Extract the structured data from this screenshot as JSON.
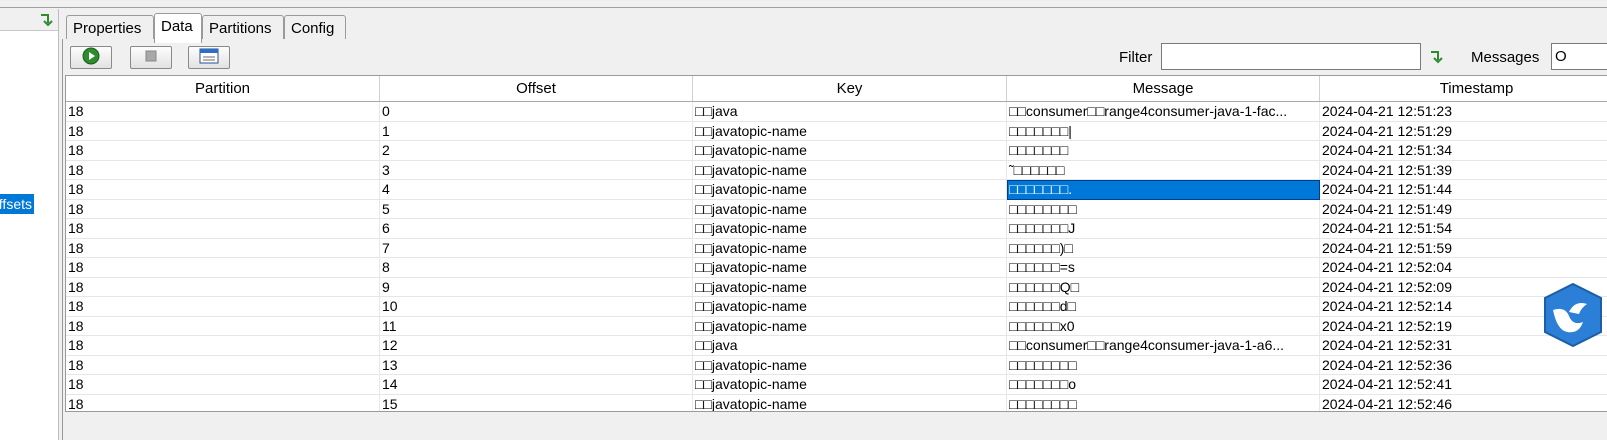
{
  "left": {
    "refresh_icon": "refresh-arrow-icon",
    "selected_item": "Offsets"
  },
  "tabs": [
    {
      "label": "Properties",
      "active": false
    },
    {
      "label": "Data",
      "active": true
    },
    {
      "label": "Partitions",
      "active": false
    },
    {
      "label": "Config",
      "active": false
    }
  ],
  "toolbar": {
    "play_icon": "play-icon",
    "stop_icon": "stop-icon",
    "window_icon": "window-icon",
    "filter_label": "Filter",
    "filter_value": "",
    "filter_apply_icon": "filter-arrow-icon",
    "messages_label": "Messages",
    "messages_value": "O"
  },
  "colors": {
    "selection": "#0078d7",
    "play_green": "#2e8b2e",
    "badge_blue": "#2b7fd6"
  },
  "table": {
    "columns": [
      "Partition",
      "Offset",
      "Key",
      "Message",
      "Timestamp"
    ],
    "selected_row": 4,
    "selected_column": "Message",
    "rows": [
      {
        "partition": "18",
        "offset": "0",
        "key": "□□java",
        "message": "□□consumer□□range4consumer-java-1-fac...",
        "timestamp": "2024-04-21 12:51:23"
      },
      {
        "partition": "18",
        "offset": "1",
        "key": "□□javatopic-name",
        "message": "□□□□□□□|",
        "timestamp": "2024-04-21 12:51:29"
      },
      {
        "partition": "18",
        "offset": "2",
        "key": "□□javatopic-name",
        "message": "□□□□□□□",
        "timestamp": "2024-04-21 12:51:34"
      },
      {
        "partition": "18",
        "offset": "3",
        "key": "□□javatopic-name",
        "message": "˜□□□□□□",
        "timestamp": "2024-04-21 12:51:39"
      },
      {
        "partition": "18",
        "offset": "4",
        "key": "□□javatopic-name",
        "message": "□□□□□□□.",
        "timestamp": "2024-04-21 12:51:44"
      },
      {
        "partition": "18",
        "offset": "5",
        "key": "□□javatopic-name",
        "message": "□□□□□□□□",
        "timestamp": "2024-04-21 12:51:49"
      },
      {
        "partition": "18",
        "offset": "6",
        "key": "□□javatopic-name",
        "message": "□□□□□□□J",
        "timestamp": "2024-04-21 12:51:54"
      },
      {
        "partition": "18",
        "offset": "7",
        "key": "□□javatopic-name",
        "message": "□□□□□□)□",
        "timestamp": "2024-04-21 12:51:59"
      },
      {
        "partition": "18",
        "offset": "8",
        "key": "□□javatopic-name",
        "message": "□□□□□□=s",
        "timestamp": "2024-04-21 12:52:04"
      },
      {
        "partition": "18",
        "offset": "9",
        "key": "□□javatopic-name",
        "message": "□□□□□□Q□",
        "timestamp": "2024-04-21 12:52:09"
      },
      {
        "partition": "18",
        "offset": "10",
        "key": "□□javatopic-name",
        "message": "□□□□□□d□",
        "timestamp": "2024-04-21 12:52:14"
      },
      {
        "partition": "18",
        "offset": "11",
        "key": "□□javatopic-name",
        "message": "□□□□□□x0",
        "timestamp": "2024-04-21 12:52:19"
      },
      {
        "partition": "18",
        "offset": "12",
        "key": "□□java",
        "message": "□□consumer□□range4consumer-java-1-a6...",
        "timestamp": "2024-04-21 12:52:31"
      },
      {
        "partition": "18",
        "offset": "13",
        "key": "□□javatopic-name",
        "message": "□□□□□□□□",
        "timestamp": "2024-04-21 12:52:36"
      },
      {
        "partition": "18",
        "offset": "14",
        "key": "□□javatopic-name",
        "message": "□□□□□□□o",
        "timestamp": "2024-04-21 12:52:41"
      },
      {
        "partition": "18",
        "offset": "15",
        "key": "□□javatopic-name",
        "message": "□□□□□□□□",
        "timestamp": "2024-04-21 12:52:46"
      }
    ]
  },
  "floating_badge_icon": "bird-badge-icon"
}
